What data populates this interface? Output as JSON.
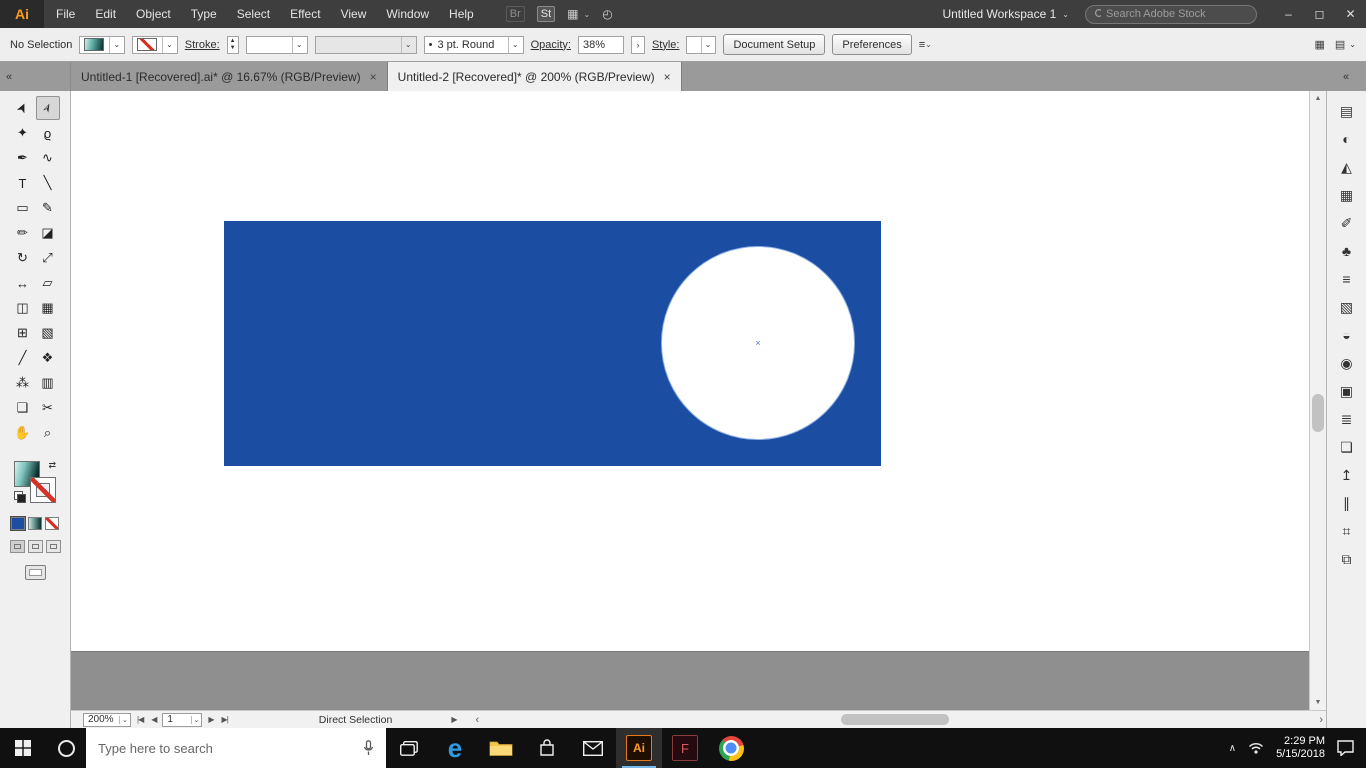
{
  "titlebar": {
    "logo": "Ai",
    "menus": [
      {
        "name": "file",
        "label": "File"
      },
      {
        "name": "edit",
        "label": "Edit"
      },
      {
        "name": "object",
        "label": "Object"
      },
      {
        "name": "type",
        "label": "Type"
      },
      {
        "name": "select",
        "label": "Select"
      },
      {
        "name": "effect",
        "label": "Effect"
      },
      {
        "name": "view",
        "label": "View"
      },
      {
        "name": "window",
        "label": "Window"
      },
      {
        "name": "help",
        "label": "Help"
      }
    ],
    "bridge_label": "Br",
    "stock_label": "St",
    "workspace_label": "Untitled Workspace 1",
    "search_placeholder": "Search Adobe Stock",
    "window_controls": {
      "minimize": "–",
      "maximize": "◻",
      "close": "✕"
    }
  },
  "controlbar": {
    "selection_status": "No Selection",
    "stroke_label": "Stroke:",
    "brush_value": "3 pt. Round",
    "opacity_label": "Opacity:",
    "opacity_value": "38%",
    "style_label": "Style:",
    "document_setup_label": "Document Setup",
    "preferences_label": "Preferences"
  },
  "tabs": [
    {
      "name": "untitled-1",
      "label": "Untitled-1 [Recovered].ai* @ 16.67% (RGB/Preview)",
      "close": "×",
      "active": false
    },
    {
      "name": "untitled-2",
      "label": "Untitled-2 [Recovered]* @ 200% (RGB/Preview)",
      "close": "×",
      "active": true
    }
  ],
  "toolbar": {
    "tools": [
      {
        "name": "selection",
        "glyph": "➤"
      },
      {
        "name": "direct-selection",
        "glyph": "➢",
        "active": true
      },
      {
        "name": "magic-wand",
        "glyph": "✦"
      },
      {
        "name": "lasso",
        "glyph": "ϱ"
      },
      {
        "name": "pen",
        "glyph": "✒"
      },
      {
        "name": "curvature",
        "glyph": "∿"
      },
      {
        "name": "type",
        "glyph": "T"
      },
      {
        "name": "line-segment",
        "glyph": "╲"
      },
      {
        "name": "rectangle",
        "glyph": "▭"
      },
      {
        "name": "paintbrush",
        "glyph": "✎"
      },
      {
        "name": "pencil",
        "glyph": "✏"
      },
      {
        "name": "eraser",
        "glyph": "◪"
      },
      {
        "name": "rotate",
        "glyph": "↻"
      },
      {
        "name": "scale",
        "glyph": "⤢"
      },
      {
        "name": "width",
        "glyph": "↔"
      },
      {
        "name": "free-transform",
        "glyph": "▱"
      },
      {
        "name": "shape-builder",
        "glyph": "◫"
      },
      {
        "name": "perspective-grid",
        "glyph": "▦"
      },
      {
        "name": "mesh",
        "glyph": "⊞"
      },
      {
        "name": "gradient",
        "glyph": "▧"
      },
      {
        "name": "eyedropper",
        "glyph": "╱"
      },
      {
        "name": "blend",
        "glyph": "❖"
      },
      {
        "name": "symbol-sprayer",
        "glyph": "⁂"
      },
      {
        "name": "column-graph",
        "glyph": "▥"
      },
      {
        "name": "artboard",
        "glyph": "❏"
      },
      {
        "name": "slice",
        "glyph": "✂"
      },
      {
        "name": "hand",
        "glyph": "✋"
      },
      {
        "name": "zoom",
        "glyph": "⌕"
      }
    ]
  },
  "right_dock": {
    "panels": [
      {
        "name": "libraries",
        "glyph": "▤"
      },
      {
        "name": "color",
        "glyph": "◐"
      },
      {
        "name": "color-guide",
        "glyph": "◭"
      },
      {
        "name": "swatches",
        "glyph": "▦"
      },
      {
        "name": "brushes",
        "glyph": "✐"
      },
      {
        "name": "symbols",
        "glyph": "♣"
      },
      {
        "name": "stroke",
        "glyph": "≡"
      },
      {
        "name": "gradient",
        "glyph": "▧"
      },
      {
        "name": "transparency",
        "glyph": "◒"
      },
      {
        "name": "appearance",
        "glyph": "◉"
      },
      {
        "name": "graphic-styles",
        "glyph": "▣"
      },
      {
        "name": "layers",
        "glyph": "≣"
      },
      {
        "name": "artboards",
        "glyph": "❏"
      },
      {
        "name": "asset-export",
        "glyph": "↥"
      },
      {
        "name": "align",
        "glyph": "∥"
      },
      {
        "name": "transform",
        "glyph": "⌗"
      },
      {
        "name": "pathfinder",
        "glyph": "⧉"
      }
    ]
  },
  "statusbar": {
    "zoom": "200%",
    "artboard_number": "1",
    "tool_name": "Direct Selection"
  },
  "canvas": {
    "rect_fill": "#1b4ea3",
    "circle_fill": "#ffffff",
    "circle_stroke": "#8fb2e8"
  },
  "taskbar": {
    "search_placeholder": "Type here to search",
    "edge_glyph": "e",
    "ai_glyph": "Ai",
    "f_glyph": "F",
    "time": "2:29 PM",
    "date": "5/15/2018"
  }
}
